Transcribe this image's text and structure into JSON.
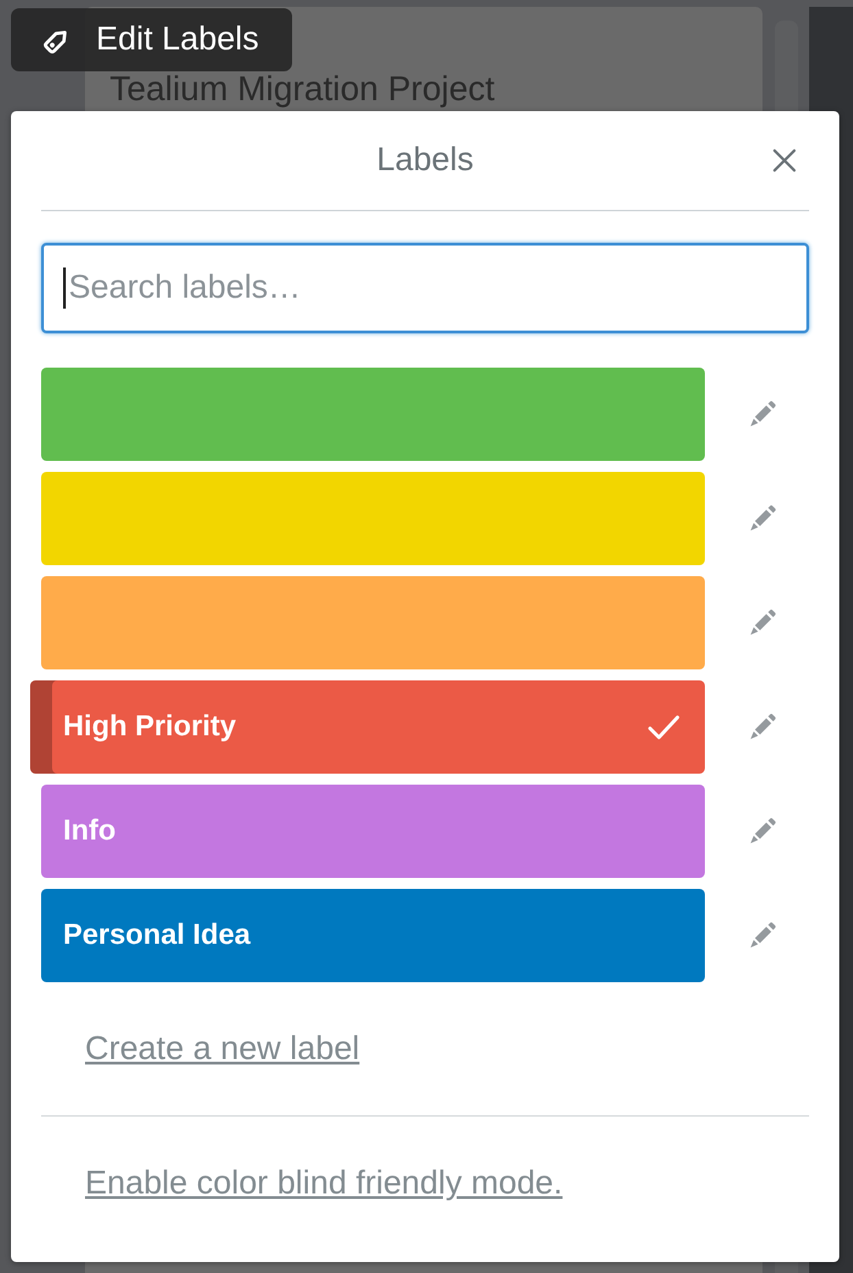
{
  "background": {
    "card_title": "Tealium Migration Project"
  },
  "quick_edit": {
    "button": "Edit Labels"
  },
  "popover": {
    "title": "Labels",
    "search": {
      "placeholder": "Search labels…"
    },
    "labels": [
      {
        "color": "#61bd4f",
        "selected": false
      },
      {
        "color": "#f2d600",
        "selected": false
      },
      {
        "color": "#ffab4a",
        "selected": false
      },
      {
        "name": "High Priority",
        "color": "#eb5a46",
        "selected": true
      },
      {
        "name": "Info",
        "color": "#c377e0",
        "selected": false
      },
      {
        "name": "Personal Idea",
        "color": "#0079bf",
        "selected": false
      }
    ],
    "create_link": "Create a new label",
    "colorblind_link": "Enable color blind friendly mode."
  }
}
